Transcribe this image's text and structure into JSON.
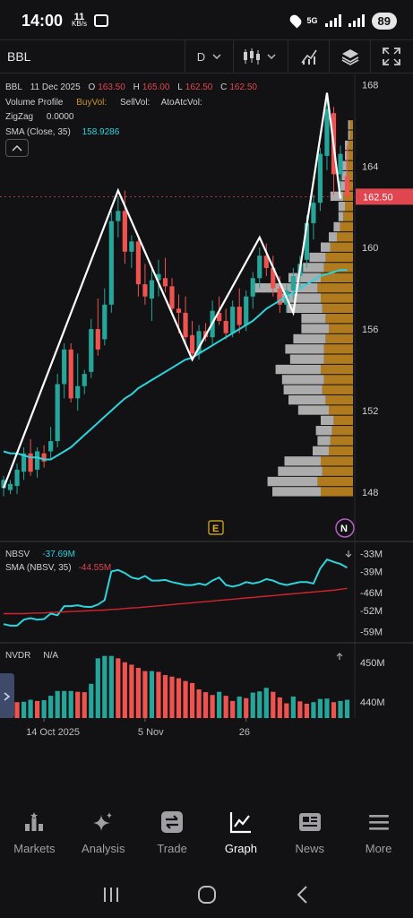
{
  "status_bar": {
    "time": "14:00",
    "net_speed_value": "11",
    "net_speed_unit": "KB/s",
    "network": "5G",
    "battery": "89"
  },
  "toolbar": {
    "symbol": "BBL",
    "interval": "D"
  },
  "legend": {
    "symbol": "BBL",
    "date": "11 Dec 2025",
    "o_label": "O",
    "o_value": "163.50",
    "h_label": "H",
    "h_value": "165.00",
    "l_label": "L",
    "l_value": "162.50",
    "c_label": "C",
    "c_value": "162.50",
    "volume_profile": "Volume Profile",
    "buy_vol": "BuyVol:",
    "sell_vol": "SellVol:",
    "ato_atc_vol": "AtoAtcVol:",
    "zigzag_label": "ZigZag",
    "zigzag_value": "0.0000",
    "sma_label": "SMA (Close, 35)",
    "sma_value": "158.9286"
  },
  "nbsv_pane": {
    "label": "NBSV",
    "value": "-37.69M",
    "sma_label": "SMA (NBSV, 35)",
    "sma_value": "-44.55M",
    "axis_ticks": [
      "-33M",
      "-39M",
      "-46M",
      "-52M",
      "-59M"
    ]
  },
  "nvdr_pane": {
    "label": "NVDR",
    "value": "N/A",
    "axis_ticks": [
      "450M",
      "440M"
    ]
  },
  "price_axis": {
    "ticks": [
      "168",
      "164",
      "160",
      "156",
      "152",
      "148"
    ],
    "current_price": "162.50"
  },
  "time_axis": {
    "labels": [
      "14 Oct 2025",
      "5 Nov",
      "26"
    ]
  },
  "markers": {
    "earnings": "E",
    "news": "N"
  },
  "nav": {
    "items": [
      {
        "label": "Markets",
        "icon": "markets-icon"
      },
      {
        "label": "Analysis",
        "icon": "analysis-icon"
      },
      {
        "label": "Trade",
        "icon": "trade-icon"
      },
      {
        "label": "Graph",
        "icon": "graph-icon",
        "active": true
      },
      {
        "label": "News",
        "icon": "news-icon"
      },
      {
        "label": "More",
        "icon": "more-icon"
      }
    ]
  },
  "colors": {
    "up": "#26a69a",
    "down": "#ef5350",
    "sma": "#2ed3dc",
    "zigzag": "#ffffff",
    "profile_buy": "#b07a1f",
    "profile_sell": "#c8c8c8",
    "price_tag": "#e0464f"
  },
  "chart_data": {
    "type": "candlestick",
    "ylim": [
      146.5,
      168.5
    ],
    "price_ticks": [
      148,
      152,
      156,
      160,
      164,
      168
    ],
    "candles": [
      {
        "o": 148.2,
        "h": 148.8,
        "l": 147.8,
        "c": 148.6
      },
      {
        "o": 148.1,
        "h": 148.6,
        "l": 147.9,
        "c": 148.4
      },
      {
        "o": 148.3,
        "h": 149.4,
        "l": 147.9,
        "c": 149.1
      },
      {
        "o": 149.0,
        "h": 150.2,
        "l": 148.6,
        "c": 149.9
      },
      {
        "o": 149.9,
        "h": 150.6,
        "l": 148.8,
        "c": 149.0
      },
      {
        "o": 149.1,
        "h": 150.2,
        "l": 148.7,
        "c": 150.0
      },
      {
        "o": 149.9,
        "h": 150.3,
        "l": 149.2,
        "c": 149.5
      },
      {
        "o": 150.0,
        "h": 151.2,
        "l": 149.6,
        "c": 150.5
      },
      {
        "o": 150.5,
        "h": 153.8,
        "l": 150.2,
        "c": 153.3
      },
      {
        "o": 153.3,
        "h": 155.3,
        "l": 152.6,
        "c": 155.0
      },
      {
        "o": 155.0,
        "h": 155.3,
        "l": 152.4,
        "c": 152.6
      },
      {
        "o": 152.6,
        "h": 154.8,
        "l": 152.0,
        "c": 153.2
      },
      {
        "o": 153.2,
        "h": 154.0,
        "l": 152.8,
        "c": 153.8
      },
      {
        "o": 153.9,
        "h": 156.5,
        "l": 153.6,
        "c": 156.0
      },
      {
        "o": 156.0,
        "h": 157.5,
        "l": 154.7,
        "c": 155.0
      },
      {
        "o": 155.5,
        "h": 158.0,
        "l": 155.2,
        "c": 157.2
      },
      {
        "o": 157.2,
        "h": 161.8,
        "l": 156.8,
        "c": 161.3
      },
      {
        "o": 161.3,
        "h": 162.5,
        "l": 160.5,
        "c": 161.8
      },
      {
        "o": 161.8,
        "h": 162.8,
        "l": 159.2,
        "c": 159.8
      },
      {
        "o": 159.8,
        "h": 160.6,
        "l": 159.0,
        "c": 160.3
      },
      {
        "o": 160.3,
        "h": 160.6,
        "l": 157.6,
        "c": 158.2
      },
      {
        "o": 158.2,
        "h": 159.2,
        "l": 157.2,
        "c": 157.6
      },
      {
        "o": 157.5,
        "h": 159.0,
        "l": 156.4,
        "c": 158.4
      },
      {
        "o": 158.4,
        "h": 159.4,
        "l": 157.6,
        "c": 158.7
      },
      {
        "o": 158.5,
        "h": 159.5,
        "l": 157.8,
        "c": 158.1
      },
      {
        "o": 158.1,
        "h": 158.5,
        "l": 156.8,
        "c": 157.0
      },
      {
        "o": 157.0,
        "h": 157.7,
        "l": 155.8,
        "c": 156.8
      },
      {
        "o": 156.8,
        "h": 157.6,
        "l": 155.2,
        "c": 155.6
      },
      {
        "o": 155.7,
        "h": 156.4,
        "l": 154.5,
        "c": 154.8
      },
      {
        "o": 154.8,
        "h": 156.2,
        "l": 154.5,
        "c": 155.9
      },
      {
        "o": 155.9,
        "h": 156.3,
        "l": 155.4,
        "c": 155.6
      },
      {
        "o": 155.6,
        "h": 157.4,
        "l": 155.2,
        "c": 156.9
      },
      {
        "o": 156.8,
        "h": 157.6,
        "l": 156.2,
        "c": 156.4
      },
      {
        "o": 156.4,
        "h": 157.0,
        "l": 155.5,
        "c": 155.8
      },
      {
        "o": 155.8,
        "h": 157.4,
        "l": 155.6,
        "c": 157.1
      },
      {
        "o": 157.1,
        "h": 158.0,
        "l": 155.8,
        "c": 156.2
      },
      {
        "o": 156.2,
        "h": 157.9,
        "l": 155.9,
        "c": 157.6
      },
      {
        "o": 157.6,
        "h": 158.8,
        "l": 157.0,
        "c": 158.5
      },
      {
        "o": 158.5,
        "h": 160.0,
        "l": 158.0,
        "c": 159.6
      },
      {
        "o": 159.6,
        "h": 160.2,
        "l": 158.6,
        "c": 159.0
      },
      {
        "o": 159.0,
        "h": 159.6,
        "l": 157.6,
        "c": 158.0
      },
      {
        "o": 158.0,
        "h": 158.6,
        "l": 156.8,
        "c": 157.2
      },
      {
        "o": 157.2,
        "h": 158.2,
        "l": 156.8,
        "c": 157.9
      },
      {
        "o": 157.9,
        "h": 159.0,
        "l": 157.4,
        "c": 158.6
      },
      {
        "o": 158.6,
        "h": 159.6,
        "l": 158.0,
        "c": 159.2
      },
      {
        "o": 159.4,
        "h": 161.6,
        "l": 159.0,
        "c": 161.2
      },
      {
        "o": 161.2,
        "h": 162.6,
        "l": 160.4,
        "c": 162.2
      },
      {
        "o": 162.2,
        "h": 164.9,
        "l": 161.8,
        "c": 164.6
      },
      {
        "o": 164.5,
        "h": 167.6,
        "l": 163.8,
        "c": 166.8
      },
      {
        "o": 166.6,
        "h": 166.9,
        "l": 162.6,
        "c": 163.6
      },
      {
        "o": 163.6,
        "h": 165.0,
        "l": 162.4,
        "c": 164.6
      },
      {
        "o": 163.5,
        "h": 165.0,
        "l": 162.5,
        "c": 162.5
      }
    ],
    "sma_close_35": [
      150.0,
      149.9,
      149.9,
      149.8,
      149.7,
      149.7,
      149.6,
      149.6,
      149.8,
      150.0,
      150.2,
      150.5,
      150.8,
      151.1,
      151.4,
      151.7,
      152.0,
      152.3,
      152.6,
      152.8,
      153.1,
      153.3,
      153.5,
      153.7,
      153.9,
      154.1,
      154.3,
      154.5,
      154.6,
      154.8,
      155.0,
      155.2,
      155.4,
      155.6,
      155.8,
      156.0,
      156.2,
      156.4,
      156.7,
      157.0,
      157.2,
      157.4,
      157.6,
      157.8,
      158.0,
      158.2,
      158.4,
      158.6,
      158.7,
      158.8,
      158.9,
      158.9
    ],
    "zigzag": [
      {
        "i": 0,
        "p": 148.2
      },
      {
        "i": 17,
        "p": 162.8
      },
      {
        "i": 28,
        "p": 154.5
      },
      {
        "i": 38,
        "p": 160.5
      },
      {
        "i": 43,
        "p": 156.8
      },
      {
        "i": 48,
        "p": 167.6
      },
      {
        "i": 50,
        "p": 162.4
      }
    ],
    "volume_profile": [
      {
        "price": 148.0,
        "buy": 40,
        "sell": 60
      },
      {
        "price": 148.5,
        "buy": 44,
        "sell": 62
      },
      {
        "price": 149.0,
        "buy": 38,
        "sell": 55
      },
      {
        "price": 149.5,
        "buy": 40,
        "sell": 45
      },
      {
        "price": 150.0,
        "buy": 30,
        "sell": 20
      },
      {
        "price": 150.5,
        "buy": 28,
        "sell": 16
      },
      {
        "price": 151.0,
        "buy": 26,
        "sell": 20
      },
      {
        "price": 151.5,
        "buy": 24,
        "sell": 16
      },
      {
        "price": 152.0,
        "buy": 30,
        "sell": 38
      },
      {
        "price": 152.5,
        "buy": 34,
        "sell": 46
      },
      {
        "price": 153.0,
        "buy": 38,
        "sell": 48
      },
      {
        "price": 153.5,
        "buy": 36,
        "sell": 52
      },
      {
        "price": 154.0,
        "buy": 40,
        "sell": 56
      },
      {
        "price": 154.5,
        "buy": 36,
        "sell": 42
      },
      {
        "price": 155.0,
        "buy": 36,
        "sell": 48
      },
      {
        "price": 155.5,
        "buy": 34,
        "sell": 40
      },
      {
        "price": 156.0,
        "buy": 30,
        "sell": 34
      },
      {
        "price": 156.5,
        "buy": 34,
        "sell": 30
      },
      {
        "price": 157.0,
        "buy": 38,
        "sell": 44
      },
      {
        "price": 157.5,
        "buy": 40,
        "sell": 54
      },
      {
        "price": 158.0,
        "buy": 44,
        "sell": 78
      },
      {
        "price": 158.5,
        "buy": 40,
        "sell": 40
      },
      {
        "price": 159.0,
        "buy": 36,
        "sell": 26
      },
      {
        "price": 159.5,
        "buy": 34,
        "sell": 20
      },
      {
        "price": 160.0,
        "buy": 28,
        "sell": 12
      },
      {
        "price": 160.5,
        "buy": 20,
        "sell": 10
      },
      {
        "price": 161.0,
        "buy": 16,
        "sell": 8
      },
      {
        "price": 161.5,
        "buy": 12,
        "sell": 6
      },
      {
        "price": 162.0,
        "buy": 10,
        "sell": 8
      },
      {
        "price": 162.5,
        "buy": 12,
        "sell": 16
      },
      {
        "price": 163.0,
        "buy": 10,
        "sell": 8
      },
      {
        "price": 163.5,
        "buy": 8,
        "sell": 6
      },
      {
        "price": 164.0,
        "buy": 8,
        "sell": 6
      },
      {
        "price": 164.5,
        "buy": 6,
        "sell": 4
      },
      {
        "price": 165.0,
        "buy": 6,
        "sell": 4
      },
      {
        "price": 165.5,
        "buy": 4,
        "sell": 2
      },
      {
        "price": 166.0,
        "buy": 4,
        "sell": 2
      }
    ],
    "nbsv": [
      -56.5,
      -57.0,
      -57.0,
      -55.0,
      -54.5,
      -55.0,
      -54.8,
      -53.0,
      -53.5,
      -50.5,
      -50.5,
      -50.2,
      -50.7,
      -50.8,
      -50.0,
      -48.5,
      -39.0,
      -38.5,
      -39.5,
      -41.0,
      -41.5,
      -40.5,
      -42.0,
      -42.0,
      -41.8,
      -42.5,
      -43.0,
      -43.5,
      -43.5,
      -43.0,
      -43.5,
      -42.0,
      -41.0,
      -43.5,
      -44.0,
      -43.5,
      -42.5,
      -43.0,
      -42.5,
      -41.5,
      -42.0,
      -43.0,
      -43.5,
      -43.0,
      -42.5,
      -42.5,
      -43.0,
      -38.0,
      -35.0,
      -35.8,
      -36.5,
      -37.7
    ],
    "nbsv_sma_35": [
      -53.0,
      -53.0,
      -53.0,
      -53.0,
      -52.9,
      -52.8,
      -52.8,
      -52.6,
      -52.5,
      -52.4,
      -52.3,
      -52.2,
      -52.1,
      -52.0,
      -51.9,
      -51.8,
      -51.6,
      -51.5,
      -51.3,
      -51.1,
      -51.0,
      -50.8,
      -50.6,
      -50.4,
      -50.2,
      -50.0,
      -49.8,
      -49.6,
      -49.4,
      -49.2,
      -49.0,
      -48.8,
      -48.6,
      -48.4,
      -48.2,
      -48.0,
      -47.8,
      -47.6,
      -47.4,
      -47.2,
      -47.0,
      -46.8,
      -46.6,
      -46.4,
      -46.2,
      -46.0,
      -45.8,
      -45.6,
      -45.4,
      -45.2,
      -44.9,
      -44.6
    ],
    "nbsv_ylim": [
      -61.5,
      -30.5
    ],
    "nvdr": [
      440.6,
      440.2,
      440.0,
      440.1,
      440.6,
      440.3,
      440.5,
      441.6,
      442.8,
      442.8,
      442.8,
      442.6,
      442.5,
      444.6,
      451.0,
      451.6,
      451.6,
      451.0,
      450.0,
      449.4,
      448.6,
      447.8,
      447.8,
      447.6,
      446.8,
      446.4,
      446.0,
      445.3,
      444.8,
      443.2,
      442.5,
      441.8,
      442.6,
      441.6,
      440.3,
      441.4,
      441.0,
      442.4,
      442.7,
      443.6,
      442.6,
      441.2,
      439.7,
      441.4,
      440.2,
      439.6,
      440.0,
      440.8,
      440.9,
      440.0,
      440.3,
      440.6
    ],
    "nvdr_ylim": [
      436,
      454
    ],
    "time_labels": [
      {
        "i": 6,
        "label": "14 Oct 2025"
      },
      {
        "i": 21,
        "label": "5 Nov"
      },
      {
        "i": 36,
        "label": "26"
      }
    ]
  }
}
